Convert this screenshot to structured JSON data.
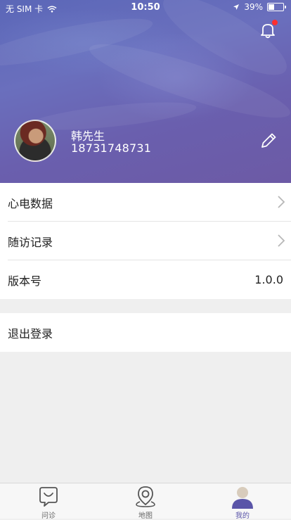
{
  "status_bar": {
    "carrier": "无 SIM 卡",
    "time": "10:50",
    "battery": "39%"
  },
  "profile": {
    "name": "韩先生",
    "phone": "18731748731",
    "notification_badge_color": "#ff2e2e",
    "header_color": "#6a64b4"
  },
  "menu": [
    {
      "label": "心电数据",
      "has_arrow": true
    },
    {
      "label": "随访记录",
      "has_arrow": true
    },
    {
      "label": "版本号",
      "value": "1.0.0"
    }
  ],
  "logout": {
    "label": "退出登录"
  },
  "tabbar": {
    "items": [
      {
        "label": "问诊",
        "icon": "chat-icon"
      },
      {
        "label": "地图",
        "icon": "map-pin-icon"
      },
      {
        "label": "我的",
        "icon": "profile-icon"
      }
    ],
    "active_index": 2,
    "active_color": "#5a55a8"
  }
}
